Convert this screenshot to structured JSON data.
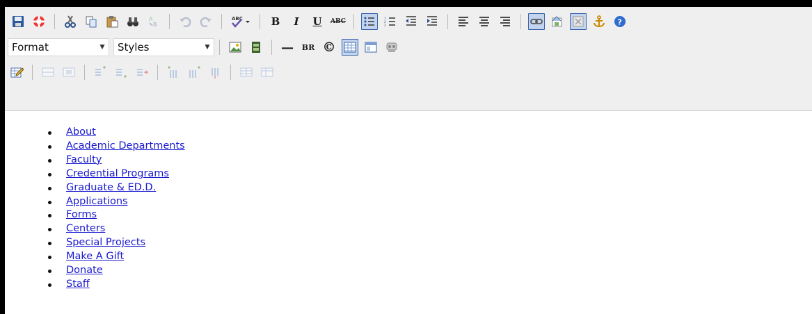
{
  "toolbar": {
    "format_select": {
      "value": "Format"
    },
    "styles_select": {
      "value": "Styles"
    },
    "bold_label": "B",
    "italic_label": "I",
    "underline_label": "U",
    "strike_label": "ABC",
    "br_label": "BR",
    "copyright_label": "©",
    "hr_label": "—",
    "active_buttons": [
      "bulleted-list",
      "link",
      "show-blocks",
      "table"
    ]
  },
  "content": {
    "links": [
      "About",
      "Academic Departments",
      "Faculty",
      "Credential Programs",
      "Graduate & ED.D.",
      "Applications",
      "Forms",
      "Centers",
      "Special Projects",
      "Make A Gift",
      "Donate",
      "Staff"
    ]
  }
}
